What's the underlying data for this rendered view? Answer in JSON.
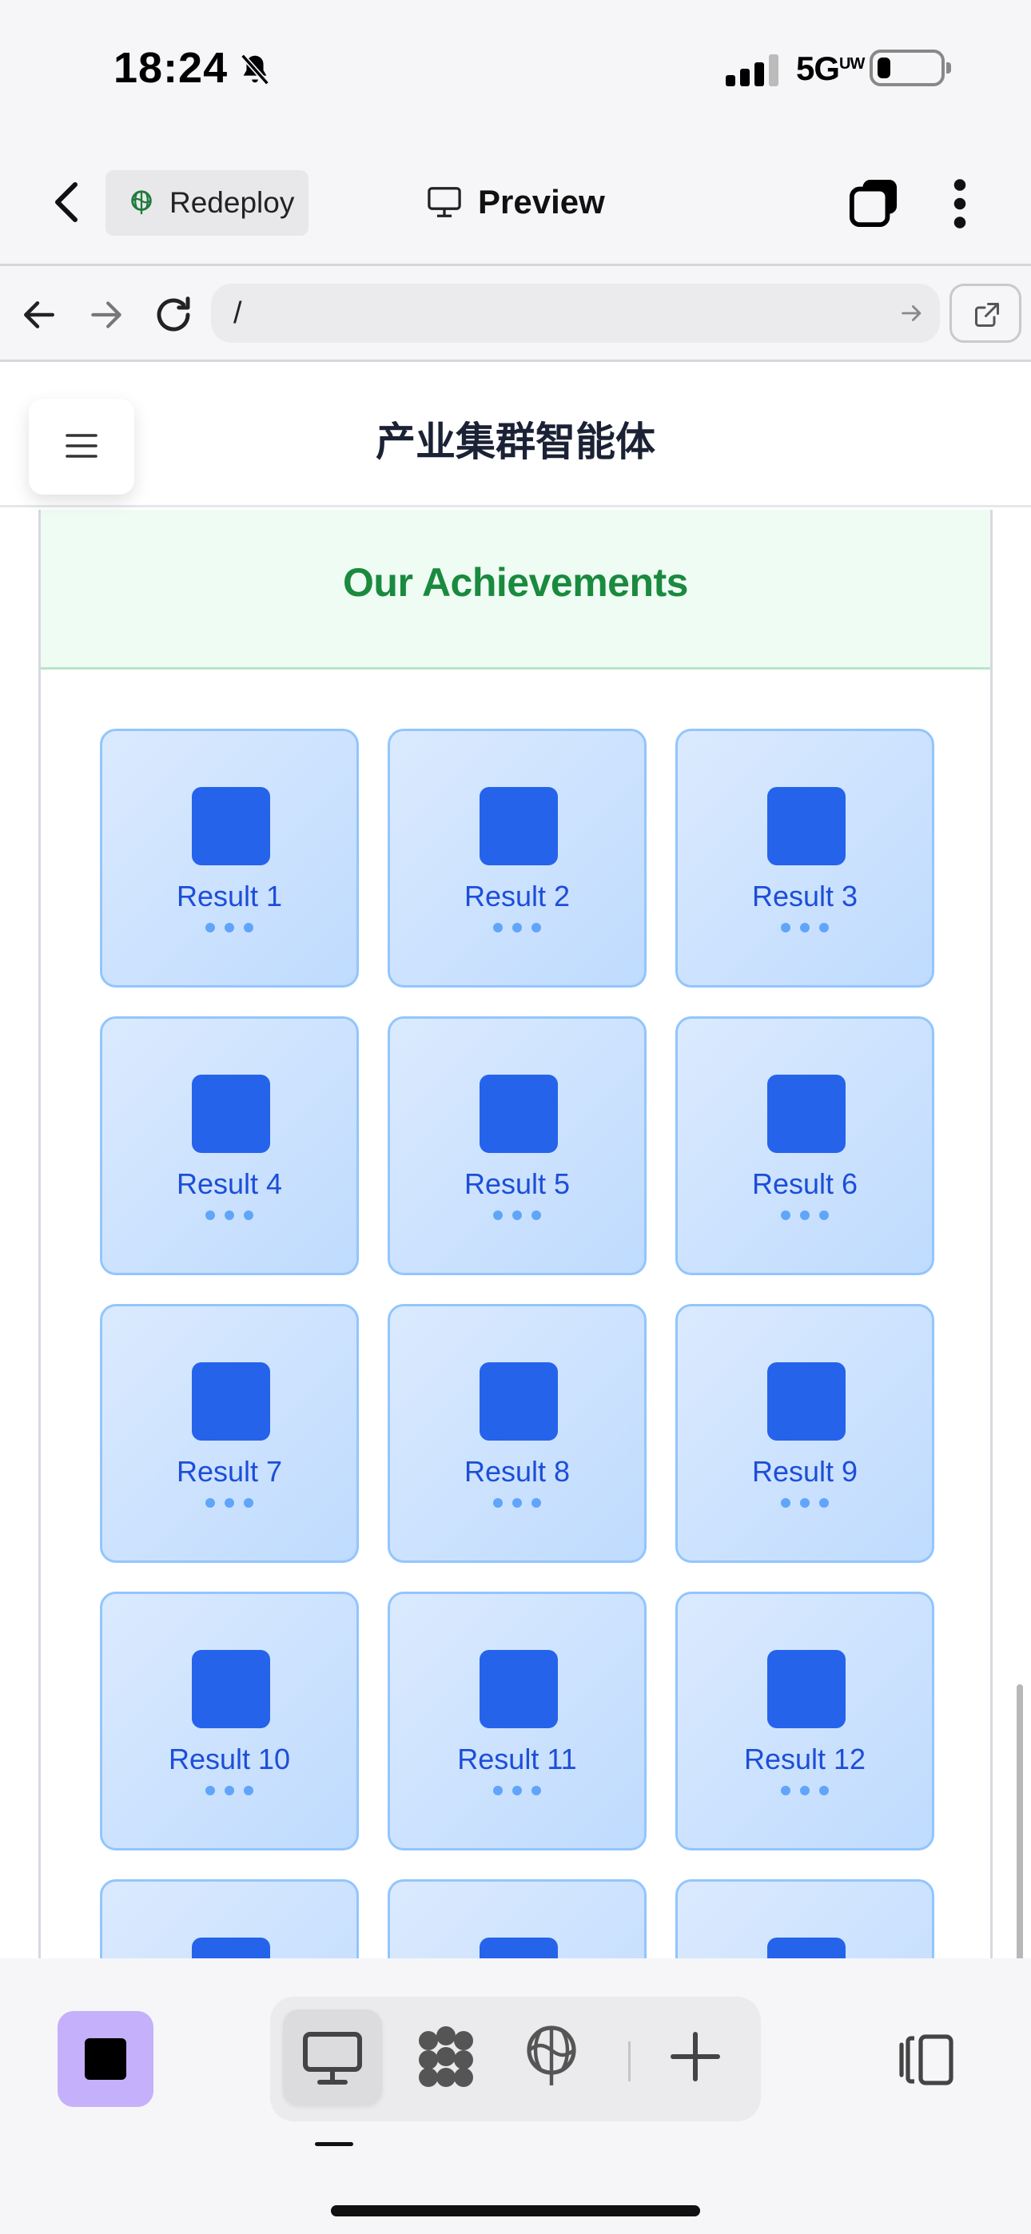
{
  "status_bar": {
    "time": "18:24",
    "network": "5G",
    "network_sub": "UW",
    "icons": [
      "bell-slash-icon",
      "signal-icon",
      "battery-icon"
    ]
  },
  "app_toolbar": {
    "redeploy_label": "Redeploy",
    "preview_label": "Preview",
    "icons": [
      "chevron-left-icon",
      "redeploy-icon",
      "monitor-icon",
      "tabs-icon",
      "more-vertical-icon"
    ]
  },
  "browser": {
    "url": "/",
    "icons": [
      "arrow-left-icon",
      "arrow-right-icon",
      "reload-icon",
      "url-go-icon",
      "external-link-icon"
    ]
  },
  "site": {
    "title": "产业集群智能体",
    "section_title": "Our Achievements",
    "results": [
      {
        "label": "Result 1"
      },
      {
        "label": "Result 2"
      },
      {
        "label": "Result 3"
      },
      {
        "label": "Result 4"
      },
      {
        "label": "Result 5"
      },
      {
        "label": "Result 6"
      },
      {
        "label": "Result 7"
      },
      {
        "label": "Result 8"
      },
      {
        "label": "Result 9"
      },
      {
        "label": "Result 10"
      },
      {
        "label": "Result 11"
      },
      {
        "label": "Result 12"
      },
      {
        "label": ""
      },
      {
        "label": ""
      },
      {
        "label": ""
      }
    ]
  },
  "colors": {
    "section_title": "#1a8a3e",
    "card_icon": "#2563eb",
    "card_text": "#1d4ed8",
    "card_border": "#93c5fd",
    "app_tile": "#c4b0fb"
  },
  "bottom_bar": {
    "icons": [
      "app-square-icon",
      "desktop-icon",
      "components-icon",
      "deploy-icon",
      "add-icon",
      "sidebar-panel-icon"
    ]
  }
}
